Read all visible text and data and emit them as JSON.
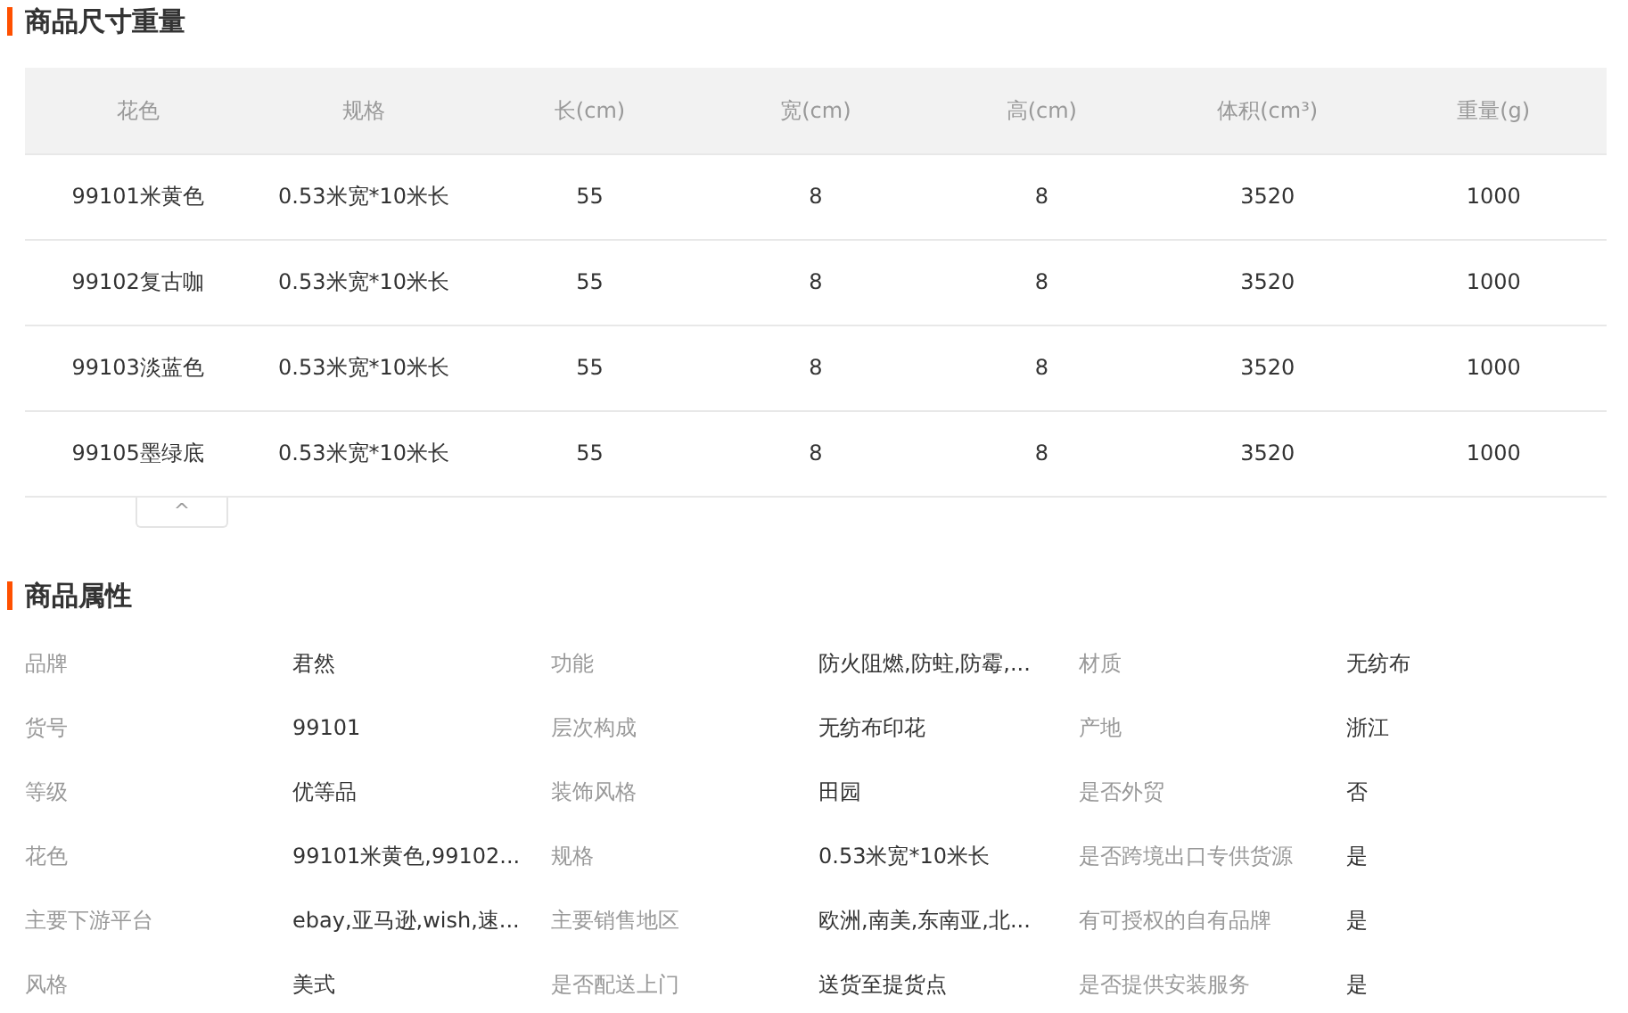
{
  "size_section": {
    "title": "商品尺寸重量",
    "table": {
      "columns": [
        "花色",
        "规格",
        "长(cm)",
        "宽(cm)",
        "高(cm)",
        "体积(cm³)",
        "重量(g)"
      ],
      "rows": [
        [
          "99101米黄色",
          "0.53米宽*10米长",
          "55",
          "8",
          "8",
          "3520",
          "1000"
        ],
        [
          "99102复古咖",
          "0.53米宽*10米长",
          "55",
          "8",
          "8",
          "3520",
          "1000"
        ],
        [
          "99103淡蓝色",
          "0.53米宽*10米长",
          "55",
          "8",
          "8",
          "3520",
          "1000"
        ],
        [
          "99105墨绿底",
          "0.53米宽*10米长",
          "55",
          "8",
          "8",
          "3520",
          "1000"
        ]
      ]
    },
    "collapse_toggle": {
      "icon": "^"
    }
  },
  "attributes_section": {
    "title": "商品属性",
    "attributes": [
      {
        "label": "品牌",
        "value": "君然"
      },
      {
        "label": "功能",
        "value": "防火阻燃,防蛀,防霉,..."
      },
      {
        "label": "材质",
        "value": "无纺布"
      },
      {
        "label": "货号",
        "value": "99101"
      },
      {
        "label": "层次构成",
        "value": "无纺布印花"
      },
      {
        "label": "产地",
        "value": "浙江"
      },
      {
        "label": "等级",
        "value": "优等品"
      },
      {
        "label": "装饰风格",
        "value": "田园"
      },
      {
        "label": "是否外贸",
        "value": "否"
      },
      {
        "label": "花色",
        "value": "99101米黄色,99102..."
      },
      {
        "label": "规格",
        "value": "0.53米宽*10米长"
      },
      {
        "label": "是否跨境出口专供货源",
        "value": "是"
      },
      {
        "label": "主要下游平台",
        "value": "ebay,亚马逊,wish,速..."
      },
      {
        "label": "主要销售地区",
        "value": "欧洲,南美,东南亚,北..."
      },
      {
        "label": "有可授权的自有品牌",
        "value": "是"
      },
      {
        "label": "风格",
        "value": "美式"
      },
      {
        "label": "是否配送上门",
        "value": "送货至提货点"
      },
      {
        "label": "是否提供安装服务",
        "value": "是"
      }
    ]
  }
}
